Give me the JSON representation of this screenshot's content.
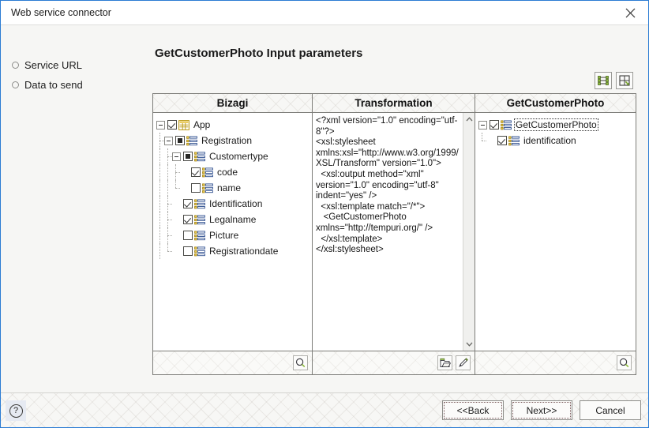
{
  "window": {
    "title": "Web service connector",
    "close_icon": "close-icon",
    "border_color": "#2b7cd3"
  },
  "sidebar": {
    "items": [
      {
        "label": "Service URL",
        "bullet_icon": "circle-bullet-icon"
      },
      {
        "label": "Data to send",
        "bullet_icon": "circle-bullet-icon"
      }
    ]
  },
  "main": {
    "page_title": "GetCustomerPhoto Input parameters",
    "toolbar": {
      "buttons": [
        {
          "name": "mapping-view-button",
          "icon": "mapping-icon",
          "tooltip": "Mapping view"
        },
        {
          "name": "layout-view-button",
          "icon": "layout-panel-icon",
          "tooltip": "Layout view"
        }
      ]
    }
  },
  "panels": {
    "source": {
      "header": "Bizagi",
      "footer_buttons": [
        {
          "name": "search-button",
          "icon": "magnifier-icon"
        }
      ],
      "tree": [
        {
          "label": "App",
          "depth": 0,
          "checkbox": "checked",
          "icon": "table-grid-icon",
          "expander": "expanded",
          "selected": false
        },
        {
          "label": "Registration",
          "depth": 1,
          "checkbox": "partial",
          "icon": "list-entity-icon",
          "expander": "expanded",
          "selected": false
        },
        {
          "label": "Customertype",
          "depth": 2,
          "checkbox": "partial",
          "icon": "list-entity-icon",
          "expander": "expanded",
          "selected": false
        },
        {
          "label": "code",
          "depth": 3,
          "checkbox": "checked",
          "icon": "list-entity-icon",
          "expander": "none",
          "selected": false
        },
        {
          "label": "name",
          "depth": 3,
          "checkbox": "unchecked",
          "icon": "list-entity-icon",
          "expander": "none",
          "selected": false
        },
        {
          "label": "Identification",
          "depth": 2,
          "checkbox": "checked",
          "icon": "list-entity-icon",
          "expander": "none",
          "selected": false
        },
        {
          "label": "Legalname",
          "depth": 2,
          "checkbox": "checked",
          "icon": "list-entity-icon",
          "expander": "none",
          "selected": false
        },
        {
          "label": "Picture",
          "depth": 2,
          "checkbox": "unchecked",
          "icon": "list-entity-icon",
          "expander": "none",
          "selected": false
        },
        {
          "label": "Registrationdate",
          "depth": 2,
          "checkbox": "unchecked",
          "icon": "list-entity-icon",
          "expander": "none",
          "selected": false
        }
      ]
    },
    "transformation": {
      "header": "Transformation",
      "xml": "<?xml version=\"1.0\" encoding=\"utf-8\"?>\n<xsl:stylesheet xmlns:xsl=\"http://www.w3.org/1999/XSL/Transform\" version=\"1.0\">\n  <xsl:output method=\"xml\" version=\"1.0\" encoding=\"utf-8\" indent=\"yes\" />\n  <xsl:template match=\"/*\">\n   <GetCustomerPhoto xmlns=\"http://tempuri.org/\" />\n  </xsl:template>\n</xsl:stylesheet>",
      "scrollbar": {
        "up_icon": "chevron-up-icon",
        "down_icon": "chevron-down-icon"
      },
      "footer_buttons": [
        {
          "name": "open-file-button",
          "icon": "folder-open-icon"
        },
        {
          "name": "edit-button",
          "icon": "pencil-icon"
        }
      ]
    },
    "target": {
      "header": "GetCustomerPhoto",
      "footer_buttons": [
        {
          "name": "search-button",
          "icon": "magnifier-icon"
        }
      ],
      "tree": [
        {
          "label": "GetCustomerPhoto",
          "depth": 0,
          "checkbox": "checked",
          "icon": "list-entity-icon",
          "expander": "expanded",
          "selected": true
        },
        {
          "label": "identification",
          "depth": 1,
          "checkbox": "checked",
          "icon": "list-entity-icon",
          "expander": "none",
          "selected": false
        }
      ]
    }
  },
  "footer": {
    "help_icon": "question-mark-icon",
    "help_label": "?",
    "buttons": [
      {
        "name": "back-button",
        "label": "<<Back",
        "focused": true
      },
      {
        "name": "next-button",
        "label": "Next>>",
        "focused": true
      },
      {
        "name": "cancel-button",
        "label": "Cancel",
        "focused": false
      }
    ]
  }
}
